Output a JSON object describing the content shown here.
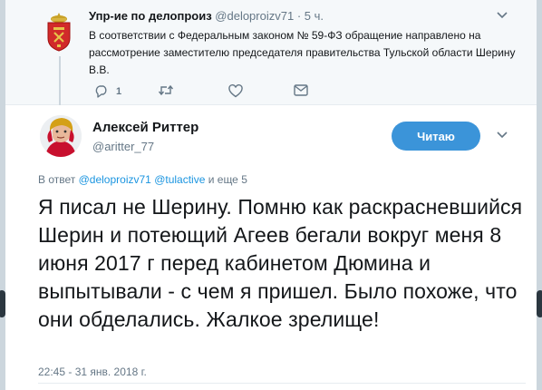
{
  "parent_tweet": {
    "author_name": "Упр-ие по делопроиз",
    "author_handle": "@deloproizv71",
    "separator": "·",
    "time": "5 ч.",
    "text": "В соответствии с Федеральным законом № 59-ФЗ обращение направлено на рассмотрение заместителю председателя правительства Тульской области Шерину В.В.",
    "reply_count": "1",
    "avatar_icon": "tula-coat-of-arms-icon",
    "caret_icon": "chevron-down-icon"
  },
  "main_tweet": {
    "author_name": "Алексей Риттер",
    "author_handle": "@aritter_77",
    "follow_button_label": "Читаю",
    "reply_prefix": "В ответ",
    "reply_mention_1": "@deloproizv71",
    "reply_mention_2": "@tulactive",
    "reply_suffix": "и еще 5",
    "text": "Я писал не Шерину. Помню как раскрасневшийся Шерин и потеющий Агеев бегали вокруг меня 8 июня 2017 г перед кабинетом Дюмина и выпытывали - с чем я пришел. Было похоже, что они обделались. Жалкое зрелище!",
    "date": "22:45 - 31 янв. 2018 г."
  },
  "colors": {
    "accent": "#1b95e0",
    "follow_button": "#3b94d9",
    "muted": "#657786",
    "text": "#14171a",
    "parent_bg": "#f5f8fa"
  }
}
